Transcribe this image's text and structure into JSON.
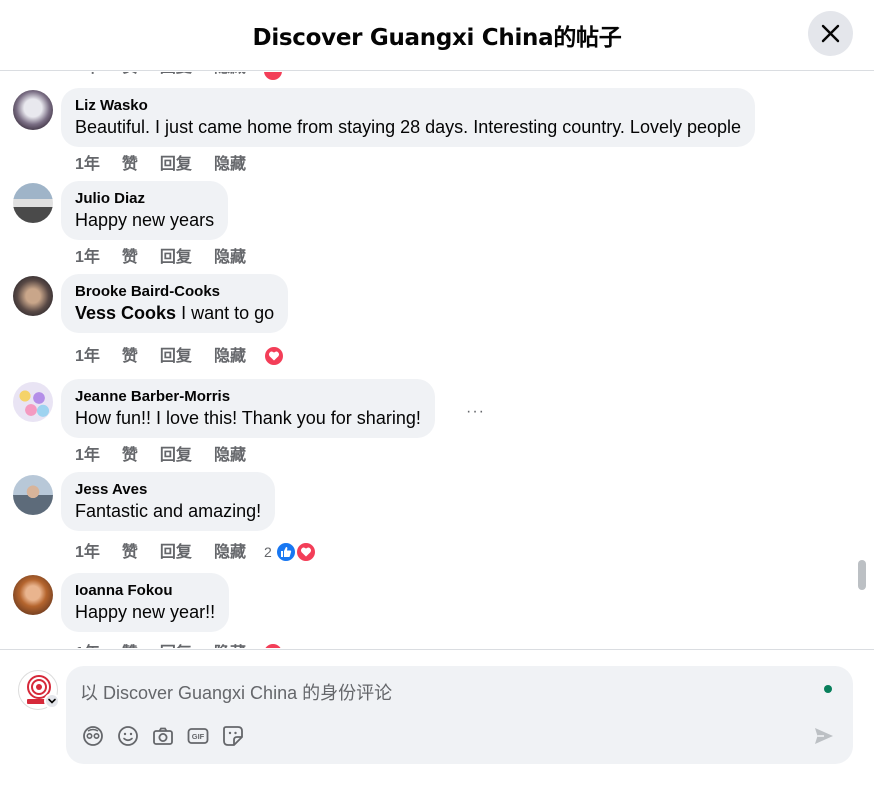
{
  "header": {
    "title": "Discover Guangxi China的帖子"
  },
  "actions": {
    "time": "1年",
    "like": "赞",
    "reply": "回复",
    "hide": "隐藏"
  },
  "comments": [
    {
      "author": "Liz Wasko",
      "text": "Beautiful. I just came home from staying 28 days. Interesting country. Lovely people"
    },
    {
      "author": "Julio Diaz",
      "text": "Happy new years"
    },
    {
      "author": "Brooke Baird-Cooks",
      "mention": "Vess Cooks",
      "text": " I want to go"
    },
    {
      "author": "Jeanne Barber-Morris",
      "text": "How fun!! I love this! Thank you for sharing!"
    },
    {
      "author": "Jess Aves",
      "text": "Fantastic and amazing!",
      "reaction_count": "2"
    },
    {
      "author": "Ioanna Fokou",
      "text": "Happy new year!!"
    }
  ],
  "more_options": "···",
  "composer": {
    "placeholder": "以 Discover Guangxi China 的身份评论"
  },
  "colors": {
    "heart": "#f33e58",
    "like": "#1877f2",
    "bubble": "#f0f2f5",
    "online": "#087f5b"
  },
  "icons": [
    "close-icon",
    "heart-reaction-icon",
    "like-reaction-icon",
    "avatar-chevron-icon",
    "avatar-icon",
    "emoji-icon",
    "camera-icon",
    "gif-icon",
    "sticker-icon",
    "send-icon"
  ]
}
